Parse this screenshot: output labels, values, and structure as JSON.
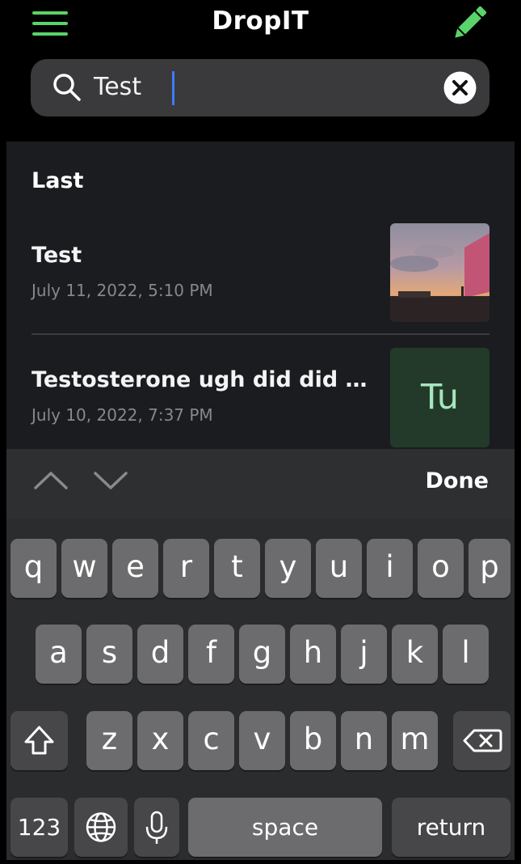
{
  "header": {
    "title": "DropIT",
    "menu_icon": "hamburger-menu-icon",
    "edit_icon": "pencil-icon",
    "accent": "#5ad36a"
  },
  "search": {
    "value": "Test",
    "search_icon": "search-icon",
    "clear_icon": "clear-icon"
  },
  "results": {
    "section_title": "Last",
    "items": [
      {
        "title": "Test",
        "date": "July 11, 2022, 5:10 PM",
        "thumbnail": "sunset-photo"
      },
      {
        "title": "Testosterone ugh did did …",
        "date": "July 10, 2022, 7:37 PM",
        "thumbnail_text": "Tu"
      }
    ]
  },
  "keyboard_toolbar": {
    "done_label": "Done",
    "prev_icon": "chevron-up-icon",
    "next_icon": "chevron-down-icon"
  },
  "keyboard": {
    "row1": [
      "q",
      "w",
      "e",
      "r",
      "t",
      "y",
      "u",
      "i",
      "o",
      "p"
    ],
    "row2": [
      "a",
      "s",
      "d",
      "f",
      "g",
      "h",
      "j",
      "k",
      "l"
    ],
    "row3": [
      "z",
      "x",
      "c",
      "v",
      "b",
      "n",
      "m"
    ],
    "numbers_label": "123",
    "space_label": "space",
    "return_label": "return",
    "shift_icon": "shift-icon",
    "delete_icon": "backspace-icon",
    "globe_icon": "globe-icon",
    "mic_icon": "microphone-icon"
  }
}
